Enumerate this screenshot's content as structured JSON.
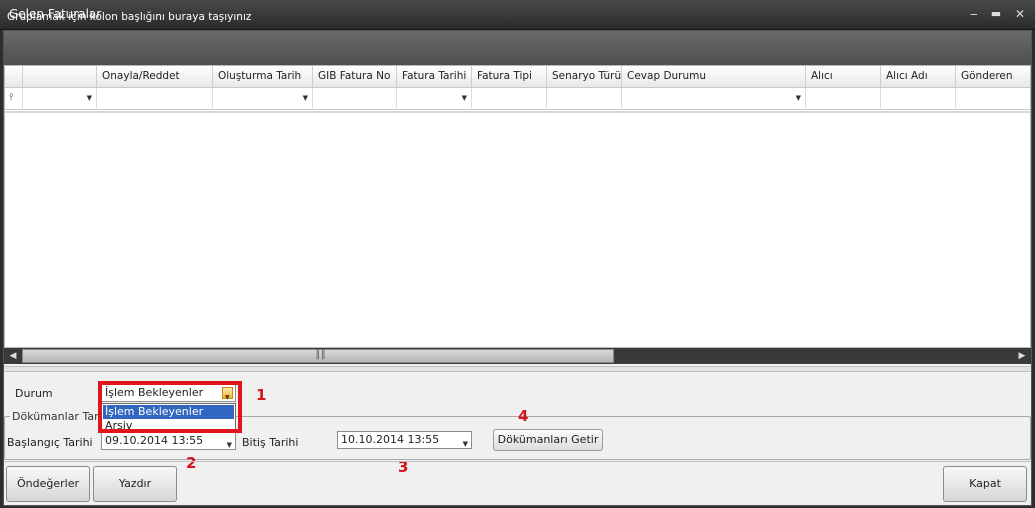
{
  "window": {
    "title": "Gelen Faturalar"
  },
  "group_panel": {
    "text": "Gruplamak için kolon başlığını buraya taşıyınız"
  },
  "grid": {
    "columns": [
      "",
      "",
      "Onayla/Reddet",
      "Oluşturma Tarih",
      "GIB Fatura No",
      "Fatura Tarihi",
      "Fatura Tipi",
      "Senaryo Türü",
      "Cevap Durumu",
      "Alıcı",
      "Alıcı Adı",
      "Gönderen"
    ]
  },
  "filter": {
    "durum_label": "Durum",
    "durum_value": "İşlem Bekleyenler",
    "durum_options": [
      "İşlem Bekleyenler",
      "Arşiv"
    ],
    "documents_legend": "Dökümanlar Tari",
    "start_label": "Başlangıç Tarihi",
    "start_value": "09.10.2014 13:55",
    "end_label": "Bitiş Tarihi",
    "end_value": "10.10.2014 13:55",
    "fetch_button": "Dökümanları Getir"
  },
  "markers": [
    "1",
    "2",
    "3",
    "4"
  ],
  "buttons": {
    "defaults": "Öndeğerler",
    "print": "Yazdır",
    "close": "Kapat"
  },
  "colors": {
    "highlight": "#e0141c",
    "marker": "#d4141b",
    "selection": "#3166c1"
  }
}
